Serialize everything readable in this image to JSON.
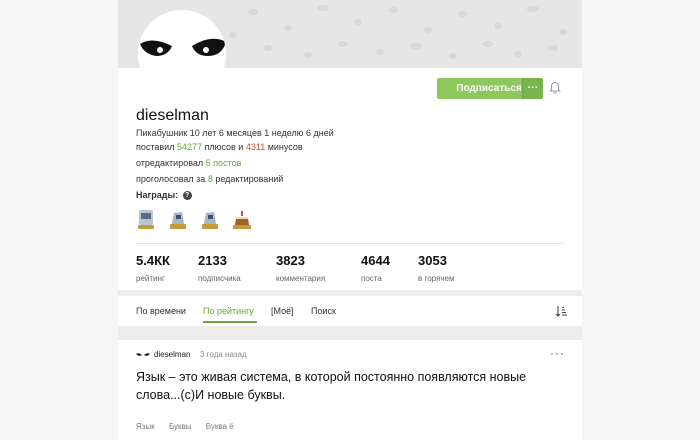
{
  "profile": {
    "username": "dieselman",
    "subscribe_label": "Подписаться",
    "more_label": "···",
    "tenure": "Пикабушник 10 лет 6 месяцев 1 неделю 6 дней",
    "votes_prefix": "поставил",
    "plus_count": "54277",
    "plus_mid": "плюсов и",
    "minus_count": "4311",
    "minus_suffix": "минусов",
    "edited_prefix": "отредактировал",
    "edited_value": "5 постов",
    "voted_prefix": "проголосовал за",
    "voted_value": "8",
    "voted_suffix": "редактирований",
    "awards_label": "Награды:",
    "awards_help": "?",
    "award_icons": [
      "ten-years-medal-icon",
      "award-icon",
      "award-icon",
      "cake-award-icon"
    ],
    "stats": [
      {
        "value": "5.4КК",
        "label": "рейтинг"
      },
      {
        "value": "2133",
        "label": "подписчика"
      },
      {
        "value": "3823",
        "label": "комментария"
      },
      {
        "value": "4644",
        "label": "поста"
      },
      {
        "value": "3053",
        "label": "в горячем"
      }
    ]
  },
  "tabs": {
    "items": [
      {
        "label": "По времени"
      },
      {
        "label": "По рейтингу"
      },
      {
        "label": "[Моё]"
      },
      {
        "label": "Поиск"
      }
    ],
    "active_index": 1
  },
  "post": {
    "author": "dieselman",
    "time": "3 года назад",
    "menu": "···",
    "title": "Язык – это живая система, в которой постоянно появляются новые слова...(с)И новые буквы.",
    "tags": [
      "Язык",
      "Буквы",
      "Буква ё"
    ]
  },
  "colors": {
    "accent": "#8dc75e",
    "accent_text": "#6aa63d",
    "minus": "#d14b2e"
  }
}
